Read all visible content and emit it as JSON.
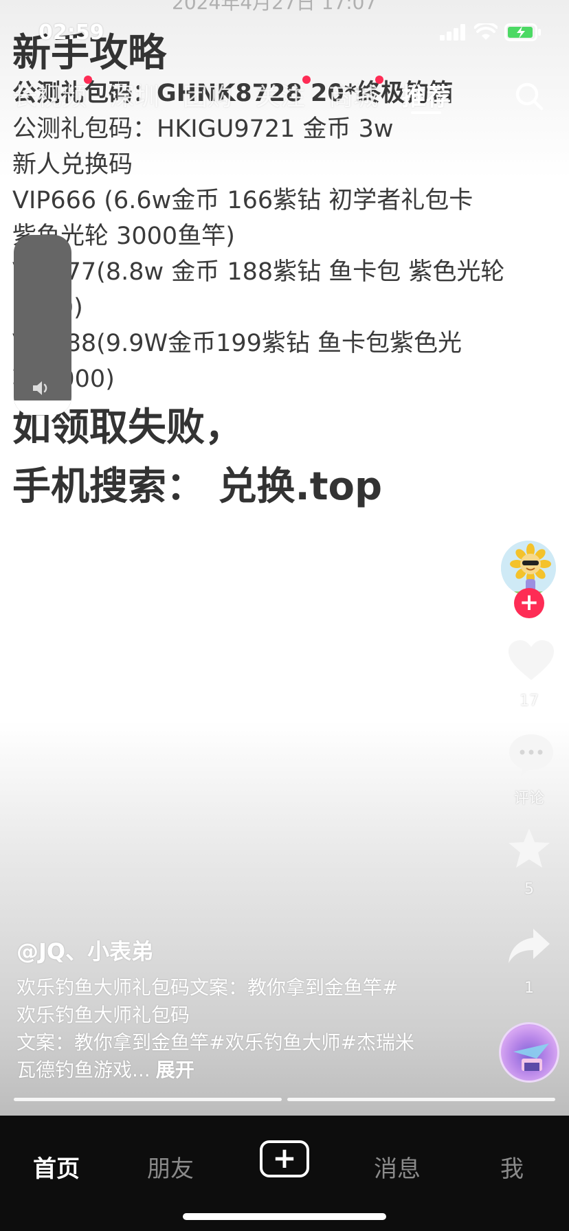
{
  "status_bar": {
    "time": "02:59"
  },
  "top_nav": {
    "tabs": [
      {
        "label": "长视频",
        "active": false,
        "dot": true
      },
      {
        "label": "深圳",
        "active": false,
        "dot": false
      },
      {
        "label": "团购",
        "active": false,
        "dot": false
      },
      {
        "label": "关注",
        "active": false,
        "dot": true
      },
      {
        "label": "商城",
        "active": false,
        "dot": true
      },
      {
        "label": "推荐",
        "active": true,
        "dot": false
      }
    ]
  },
  "post": {
    "date": "2024年4月27日 17:07",
    "title": "新手攻略",
    "lines": [
      "公测礼包码：GHNK8728  20*终极钓箱",
      "公测礼包码：HKIGU9721 金币 3w",
      "新人兑换码",
      "VIP666 (6.6w金币 166紫钻 初学者礼包卡",
      "紫鱼光轮 3000鱼竿)",
      "VIP777(8.8w 金币 188紫钻 鱼卡包 紫色光轮",
      "5000)",
      "VIP888(9.9W金币199紫钻 鱼卡包紫色光",
      "轮 8000)"
    ],
    "fail_line_1": "如领取失败，",
    "fail_line_2": "手机搜索：  兑换.top"
  },
  "rail": {
    "likes": "17",
    "comments": "评论",
    "favorites": "5",
    "shares": "1"
  },
  "caption": {
    "author": "@JQ、小表弟",
    "line1": "欢乐钓鱼大师礼包码文案：教你拿到金鱼竿#",
    "line2": "欢乐钓鱼大师礼包码",
    "line3": "文案：教你拿到金鱼竿#欢乐钓鱼大师#杰瑞米",
    "line4": "瓦德钓鱼游戏...",
    "expand": "展开"
  },
  "tabbar": {
    "home": "首页",
    "friends": "朋友",
    "messages": "消息",
    "me": "我"
  },
  "colors": {
    "accent": "#fe2c55",
    "tabbar_bg": "#0d0d0d"
  }
}
